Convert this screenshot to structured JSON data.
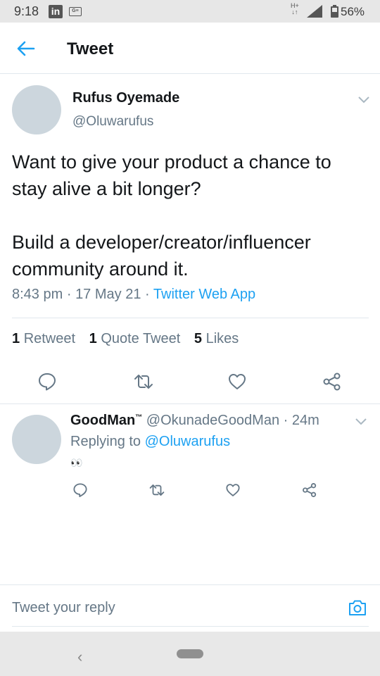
{
  "status_bar": {
    "time": "9:18",
    "linkedin_icon": "linkedin-icon",
    "gs_icon": "gs-icon",
    "network_type": "H+",
    "signal_icon": "signal-icon",
    "battery_icon": "battery-icon",
    "battery_percent": "56%"
  },
  "header": {
    "back_icon": "arrow-left-icon",
    "title": "Tweet"
  },
  "tweet": {
    "author_name": "Rufus Oyemade",
    "author_handle": "@Oluwarufus",
    "text_line1": "Want to give your product a chance to stay alive a bit longer?",
    "text_line2": "Build a developer/creator/influencer community around it.",
    "time": "8:43 pm",
    "date": "17 May 21",
    "source": "Twitter Web App",
    "separator": "·",
    "retweet_count": "1",
    "retweet_label": "Retweet",
    "quote_count": "1",
    "quote_label": "Quote Tweet",
    "like_count": "5",
    "like_label": "Likes"
  },
  "reply": {
    "author_name": "GoodMan",
    "tm": "™",
    "author_handle": "@OkunadeGoodMan",
    "age": "24m",
    "replying_prefix": "Replying to",
    "replying_to": "@Oluwarufus",
    "text": "👀"
  },
  "composer": {
    "placeholder": "Tweet your reply",
    "camera_icon": "camera-icon"
  },
  "colors": {
    "accent": "#1da1f2",
    "muted_text": "#657786",
    "avatar_placeholder": "#ccd6dd"
  }
}
